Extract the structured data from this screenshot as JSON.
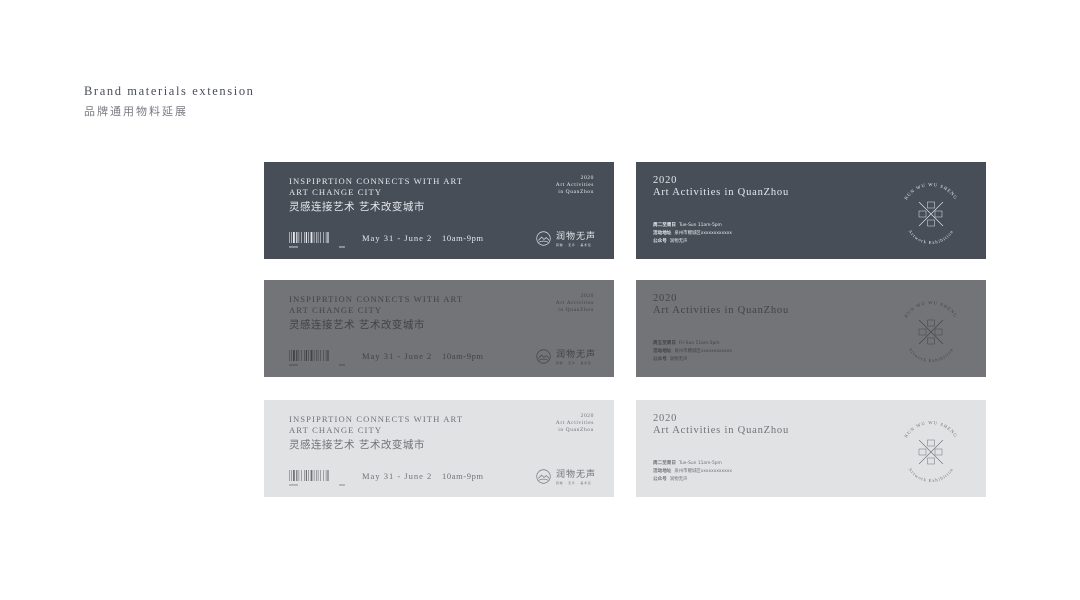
{
  "header": {
    "title_en": "Brand materials extension",
    "title_cn": "品牌通用物料延展"
  },
  "ticket_front": {
    "title_line1": "INSPIPRTION CONNECTS WITH ART",
    "title_line2": "ART CHANGE CITY",
    "subtitle_cn": "灵感连接艺术 艺术改变城市",
    "year": "2020",
    "event_line1": "Art Activities",
    "event_line2": "in QuanZhou",
    "date": "May 31 - June 2",
    "time": "10am-9pm",
    "brand_name": "润物无声",
    "brand_sub": "润物 · 无声 · 美术馆",
    "barcode_left": "000000",
    "barcode_right": "0000"
  },
  "ticket_back": {
    "year": "2020",
    "title": "Art Activities in QuanZhou",
    "stamp_top": "RUN WU WU SHENG",
    "stamp_bottom": "Artwork Exhibition",
    "info_rows": [
      {
        "label": "周二至周日",
        "value": "Tue-Sun 11am-5pm"
      },
      {
        "label": "活动地址",
        "value": "泉州市鲤城区xxxxxxxxxxxx"
      },
      {
        "label": "公众号",
        "value": "润物无声"
      }
    ],
    "info_rows_alt": [
      {
        "label": "周五至周日",
        "value": "Fri-Sun 11am-5pm"
      },
      {
        "label": "活动地址",
        "value": "泉州市鲤城区xxxxxxxxxxxx"
      },
      {
        "label": "公众号",
        "value": "润物无声"
      }
    ]
  },
  "colors": {
    "dark": "#474e58",
    "mid": "#737477",
    "light": "#e1e2e4"
  }
}
